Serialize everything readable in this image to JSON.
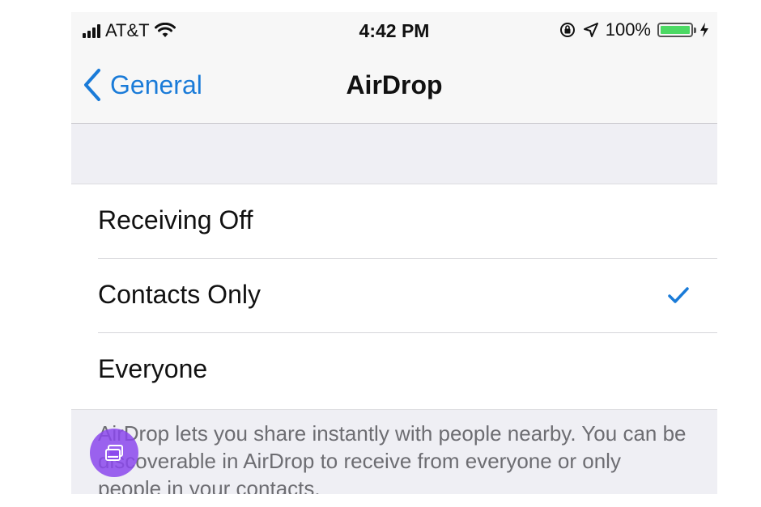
{
  "status_bar": {
    "carrier": "AT&T",
    "time": "4:42 PM",
    "battery_percent": "100%",
    "battery_level": 1.0,
    "icons": [
      "signal-bars-icon",
      "wifi-icon",
      "orientation-lock-icon",
      "location-arrow-icon",
      "battery-icon",
      "charging-bolt-icon"
    ]
  },
  "nav": {
    "back_label": "General",
    "title": "AirDrop"
  },
  "options": [
    {
      "label": "Receiving Off",
      "selected": false
    },
    {
      "label": "Contacts Only",
      "selected": true
    },
    {
      "label": "Everyone",
      "selected": false
    }
  ],
  "footer": {
    "text": "AirDrop lets you share instantly with people nearby. You can be discoverable in AirDrop to receive from everyone or only people in your contacts."
  },
  "colors": {
    "accent": "#1a7bd8",
    "battery": "#4cd964",
    "overlay": "#8b48ec",
    "background": "#efeff4"
  }
}
